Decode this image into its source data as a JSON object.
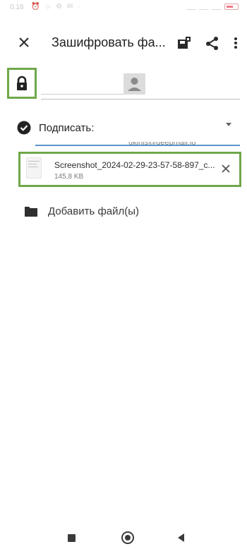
{
  "status_bar": {
    "time": "0:18",
    "left_icons": "⏰ ☼ ⚙ ✉ ·"
  },
  "toolbar": {
    "close_icon": "close-icon",
    "title": "Зашифровать фа...",
    "save_icon": "save-key-icon",
    "share_icon": "share-icon",
    "more_icon": "more-vert-icon"
  },
  "recipients": {
    "input_value": "",
    "lock_icon": "lock-icon",
    "avatar_icon": "contact-avatar-icon"
  },
  "sign": {
    "label": "Подписать:",
    "selected_email": "ukinis@deepmail.io",
    "accent_color": "#5a95c9"
  },
  "file": {
    "name": "Screenshot_2024-02-29-23-57-58-897_c...",
    "size": "145,8 KB",
    "remove_icon": "close-icon"
  },
  "add_file": {
    "label": "Добавить файл(ы)",
    "icon": "folder-icon"
  },
  "highlight_color": "#6fa84a",
  "nav": {
    "recents": "recents-icon",
    "home": "home-icon",
    "back": "back-icon"
  }
}
